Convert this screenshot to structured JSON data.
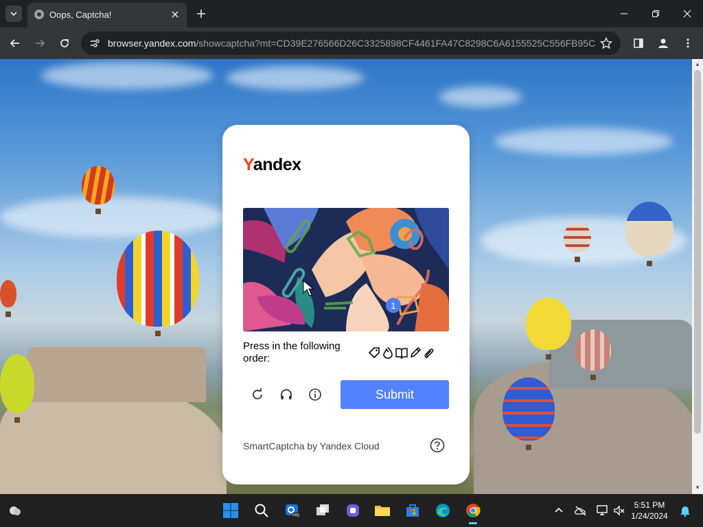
{
  "browser": {
    "tab": {
      "title": "Oops, Captcha!",
      "favicon": "globe-icon"
    },
    "url_host": "browser.yandex.com",
    "url_path": "/showcaptcha?mt=CD39E276566D26C3325898CF4461FA47C8298C6A6155525C556FB95C98..."
  },
  "captcha": {
    "logo_first": "Y",
    "logo_rest": "andex",
    "instruction": "Press in the following order:",
    "order_icons": [
      "tag-icon",
      "flame-icon",
      "book-icon",
      "pencil-icon",
      "paperclip-icon"
    ],
    "badge_number": "1",
    "submit_label": "Submit",
    "footer": "SmartCaptcha by Yandex Cloud",
    "accent_color": "#5282ff",
    "logo_color": "#fc3f1d"
  },
  "taskbar": {
    "time": "5:51 PM",
    "date": "1/24/2024",
    "apps": [
      "windows-start-icon",
      "search-icon",
      "outlook-pre-icon",
      "task-view-icon",
      "teams-icon",
      "file-explorer-icon",
      "microsoft-store-icon",
      "edge-icon",
      "chrome-icon"
    ]
  }
}
